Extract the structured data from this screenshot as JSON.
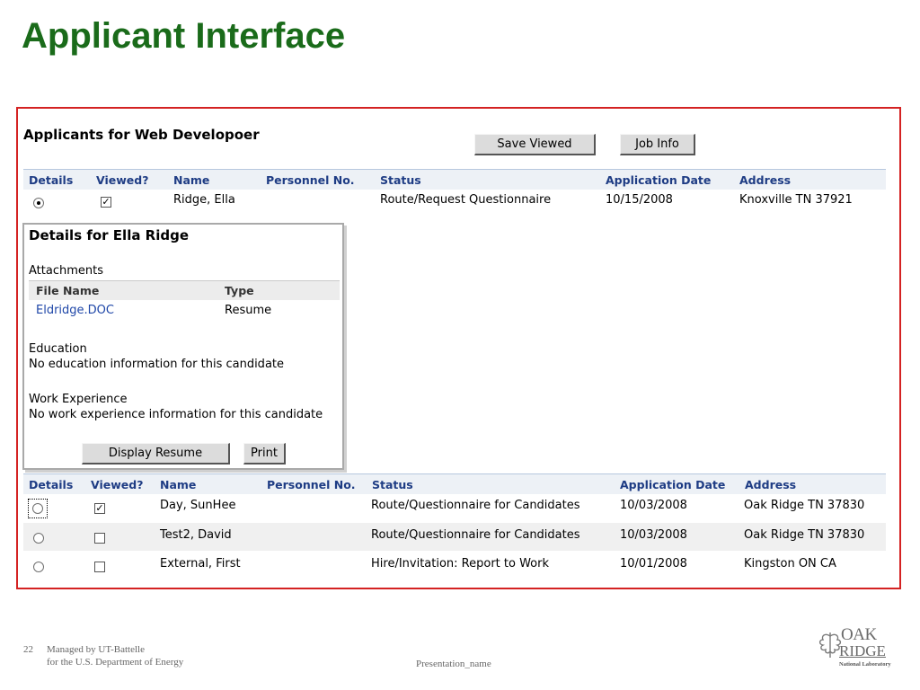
{
  "slide": {
    "title": "Applicant Interface",
    "page_number": "22",
    "footer_line1": "Managed by UT-Battelle",
    "footer_line2": "for the U.S. Department of Energy",
    "presentation_name": "Presentation_name",
    "logo": {
      "word1": "OAK",
      "word2": "RIDGE",
      "word3": "National Laboratory",
      "icon": "oak-leaf-icon"
    }
  },
  "colors": {
    "title": "#1a6b1a",
    "frame_border": "#d42222",
    "header_text": "#1e3c84",
    "link": "#1f47a8"
  },
  "panel": {
    "title": "Applicants for Web Developoer",
    "save_viewed_label": "Save Viewed",
    "job_info_label": "Job Info"
  },
  "columns_top": {
    "details": "Details",
    "viewed": "Viewed?",
    "name": "Name",
    "personnel_no": "Personnel No.",
    "status": "Status",
    "application_date": "Application Date",
    "address": "Address"
  },
  "selected_row": {
    "selected": true,
    "viewed": true,
    "name": "Ridge, Ella",
    "personnel_no": "",
    "status": "Route/Request Questionnaire",
    "application_date": "10/15/2008",
    "address": "Knoxville TN 37921"
  },
  "details": {
    "title": "Details for Ella Ridge",
    "attachments_label": "Attachments",
    "file_name_header": "File Name",
    "type_header": "Type",
    "file_name": "Eldridge.DOC",
    "file_type": "Resume",
    "education_label": "Education",
    "education_text": "No education information for this candidate",
    "work_label": "Work Experience",
    "work_text": "No work experience information for this candidate",
    "display_resume_label": "Display Resume",
    "print_label": "Print"
  },
  "columns_bottom": {
    "details": "Details",
    "viewed": "Viewed?",
    "name": "Name",
    "personnel_no": "Personnel No.",
    "status": "Status",
    "application_date": "Application Date",
    "address": "Address"
  },
  "rows": [
    {
      "selected": false,
      "viewed": true,
      "name": "Day, SunHee",
      "personnel_no": "",
      "status": "Route/Questionnaire for Candidates",
      "application_date": "10/03/2008",
      "address": "Oak Ridge TN 37830"
    },
    {
      "selected": false,
      "viewed": false,
      "name": "Test2, David",
      "personnel_no": "",
      "status": "Route/Questionnaire for Candidates",
      "application_date": "10/03/2008",
      "address": "Oak Ridge TN 37830"
    },
    {
      "selected": false,
      "viewed": false,
      "name": "External, First",
      "personnel_no": "",
      "status": "Hire/Invitation: Report to Work",
      "application_date": "10/01/2008",
      "address": "Kingston ON CA"
    }
  ]
}
